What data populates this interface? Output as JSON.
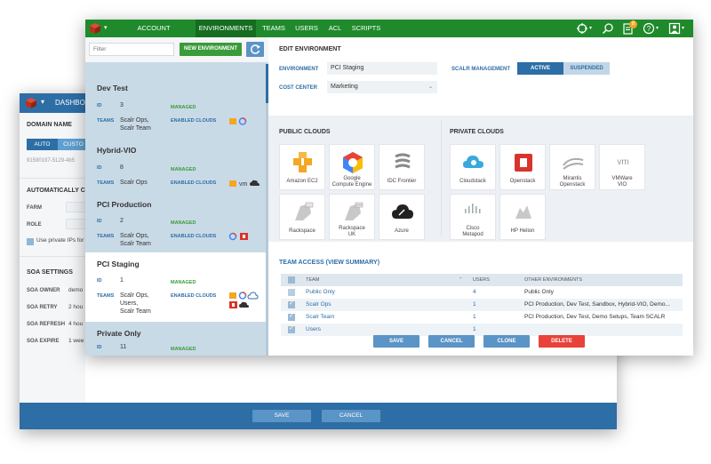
{
  "back_window": {
    "dashboard_label": "DASHBOA",
    "domain_name_heading": "DOMAIN NAME",
    "toggle": {
      "auto": "AUTO",
      "custom": "CUSTO"
    },
    "domain_id": "91590197-5129-4b5",
    "auto_create_heading": "AUTOMATICALLY CR",
    "farm_label": "FARM",
    "role_label": "ROLE",
    "private_ips_label": "Use private IPs for",
    "soa_heading": "SOA SETTINGS",
    "soa_owner_label": "SOA OWNER",
    "soa_owner_value": "demo",
    "soa_retry_label": "SOA RETRY",
    "soa_retry_value": "2 hou",
    "soa_refresh_label": "SOA REFRESH",
    "soa_refresh_value": "4 hou",
    "soa_expire_label": "SOA EXPIRE",
    "soa_expire_value": "1 wee",
    "save_label": "SAVE",
    "cancel_label": "CANCEL"
  },
  "nav": {
    "items": [
      {
        "label": "ACCOUNT DASHBOARD",
        "active": false
      },
      {
        "label": "ENVIRONMENTS",
        "active": true
      },
      {
        "label": "TEAMS",
        "active": false
      },
      {
        "label": "USERS",
        "active": false
      },
      {
        "label": "ACL",
        "active": false
      },
      {
        "label": "SCRIPTS",
        "active": false
      }
    ],
    "notification_count": "8"
  },
  "env_list": {
    "filter_placeholder": "Filter",
    "new_env_label": "NEW ENVIRONMENT",
    "id_key": "ID",
    "teams_key": "TEAMS",
    "enabled_clouds_key": "ENABLED CLOUDS",
    "managed_label": "MANAGED",
    "environments": [
      {
        "name": "Dev Test",
        "id": "3",
        "teams": "Scalr Ops,\nScalr Team",
        "clouds": ""
      },
      {
        "name": "Hybrid-VIO",
        "id": "8",
        "teams": "Scalr Ops",
        "clouds": ""
      },
      {
        "name": "PCI Production",
        "id": "2",
        "teams": "Scalr Ops,\nScalr Team",
        "clouds": ""
      },
      {
        "name": "PCI Staging",
        "id": "1",
        "teams": "Scalr Ops,\nUsers,\nScalr Team",
        "clouds": ""
      },
      {
        "name": "Private Only",
        "id": "11",
        "teams": "",
        "clouds": "none"
      }
    ]
  },
  "edit": {
    "heading": "EDIT ENVIRONMENT",
    "environment_label": "ENVIRONMENT",
    "environment_value": "PCI Staging",
    "cost_center_label": "COST CENTER",
    "cost_center_value": "Marketing",
    "scalr_mgmt_label": "SCALR MANAGEMENT",
    "active_label": "ACTIVE",
    "suspended_label": "SUSPENDED",
    "public_clouds_heading": "PUBLIC CLOUDS",
    "private_clouds_heading": "PRIVATE CLOUDS",
    "public_clouds": [
      {
        "label": "Amazon EC2"
      },
      {
        "label": "Google\nCompute Engine"
      },
      {
        "label": "IDC Frontier"
      },
      {
        "label": "Rackspace"
      },
      {
        "label": "Rackspace\nUK"
      },
      {
        "label": "Azure"
      }
    ],
    "private_clouds": [
      {
        "label": "Cloudstack"
      },
      {
        "label": "Openstack"
      },
      {
        "label": "Mirantis\nOpenstack"
      },
      {
        "label": "VMWare\nVIO"
      },
      {
        "label": "Cisco\nMetapod"
      },
      {
        "label": "HP Helion"
      }
    ],
    "team_access_heading": "TEAM ACCESS (VIEW SUMMARY)",
    "table": {
      "headers": {
        "team": "TEAM",
        "users": "USERS",
        "other": "OTHER ENVIRONMENTS"
      },
      "rows": [
        {
          "team": "Public Only",
          "users": "4",
          "other": "Public Only",
          "checked": false
        },
        {
          "team": "Scalr Ops",
          "users": "1",
          "other": "PCI Production, Dev Test, Sandbox, Hybrid-VIO, Demo...",
          "checked": true
        },
        {
          "team": "Scalr Team",
          "users": "1",
          "other": "PCI Production, Dev Test, Demo Setups, Team SCALR",
          "checked": true
        },
        {
          "team": "Users",
          "users": "1",
          "other": "",
          "checked": true
        }
      ]
    },
    "buttons": {
      "save": "SAVE",
      "cancel": "CANCEL",
      "clone": "CLONE",
      "delete": "DELETE"
    }
  }
}
